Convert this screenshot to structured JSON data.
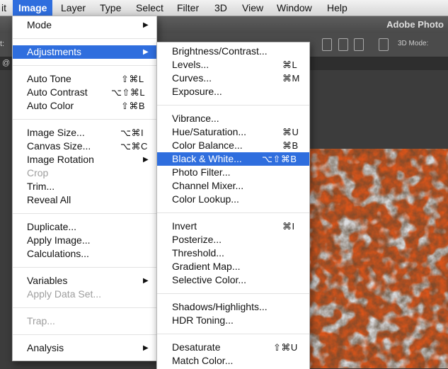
{
  "menubar": {
    "items": [
      {
        "label": "it"
      },
      {
        "label": "Image"
      },
      {
        "label": "Layer"
      },
      {
        "label": "Type"
      },
      {
        "label": "Select"
      },
      {
        "label": "Filter"
      },
      {
        "label": "3D"
      },
      {
        "label": "View"
      },
      {
        "label": "Window"
      },
      {
        "label": "Help"
      }
    ]
  },
  "app": {
    "title": "Adobe Photo",
    "options_3d": "3D Mode:",
    "left_edge_top": "t:",
    "left_edge_tab": "@"
  },
  "image_menu": {
    "items": [
      {
        "label": "Mode"
      },
      {
        "label": "Adjustments"
      },
      {
        "label": "Auto Tone",
        "shortcut": "⇧⌘L"
      },
      {
        "label": "Auto Contrast",
        "shortcut": "⌥⇧⌘L"
      },
      {
        "label": "Auto Color",
        "shortcut": "⇧⌘B"
      },
      {
        "label": "Image Size...",
        "shortcut": "⌥⌘I"
      },
      {
        "label": "Canvas Size...",
        "shortcut": "⌥⌘C"
      },
      {
        "label": "Image Rotation"
      },
      {
        "label": "Crop"
      },
      {
        "label": "Trim..."
      },
      {
        "label": "Reveal All"
      },
      {
        "label": "Duplicate..."
      },
      {
        "label": "Apply Image..."
      },
      {
        "label": "Calculations..."
      },
      {
        "label": "Variables"
      },
      {
        "label": "Apply Data Set..."
      },
      {
        "label": "Trap..."
      },
      {
        "label": "Analysis"
      }
    ]
  },
  "adjustments_menu": {
    "items": [
      {
        "label": "Brightness/Contrast..."
      },
      {
        "label": "Levels...",
        "shortcut": "⌘L"
      },
      {
        "label": "Curves...",
        "shortcut": "⌘M"
      },
      {
        "label": "Exposure..."
      },
      {
        "label": "Vibrance..."
      },
      {
        "label": "Hue/Saturation...",
        "shortcut": "⌘U"
      },
      {
        "label": "Color Balance...",
        "shortcut": "⌘B"
      },
      {
        "label": "Black & White...",
        "shortcut": "⌥⇧⌘B"
      },
      {
        "label": "Photo Filter..."
      },
      {
        "label": "Channel Mixer..."
      },
      {
        "label": "Color Lookup..."
      },
      {
        "label": "Invert",
        "shortcut": "⌘I"
      },
      {
        "label": "Posterize..."
      },
      {
        "label": "Threshold..."
      },
      {
        "label": "Gradient Map..."
      },
      {
        "label": "Selective Color..."
      },
      {
        "label": "Shadows/Highlights..."
      },
      {
        "label": "HDR Toning..."
      },
      {
        "label": "Desaturate",
        "shortcut": "⇧⌘U"
      },
      {
        "label": "Match Color..."
      }
    ]
  },
  "colors": {
    "highlight": "#2f6ede",
    "image_orange": "#d9541a"
  },
  "icons": {
    "submenu": "submenu-arrow-icon"
  }
}
